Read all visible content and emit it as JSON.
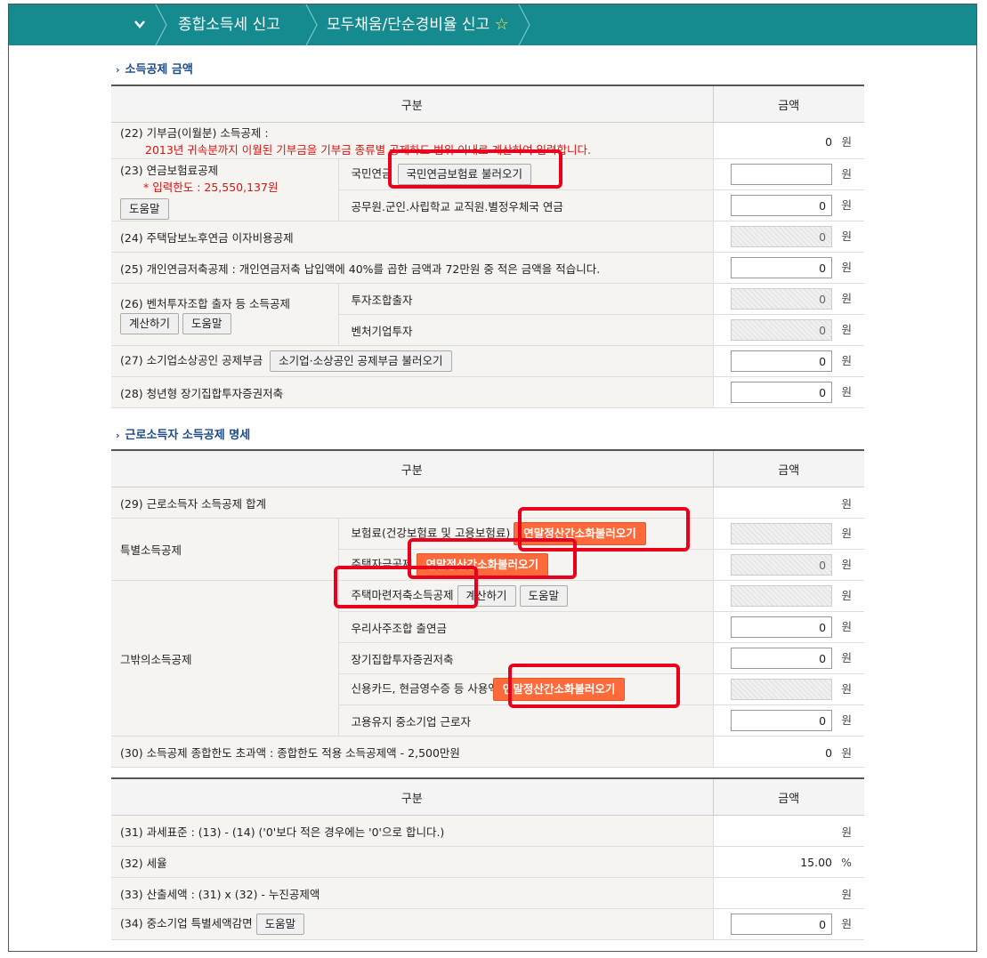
{
  "breadcrumb": {
    "item1": "종합소득세 신고",
    "item2": "모두채움/단순경비율 신고"
  },
  "icons": {
    "expand": "chevron-down-icon",
    "favorite": "star-icon",
    "section": "chevron-right-icon"
  },
  "common": {
    "won": "원",
    "percent": "%",
    "col_category": "구분",
    "col_amount": "금액"
  },
  "section1": {
    "title": "소득공제 금액",
    "rows": {
      "r22_label": "(22) 기부금(이월분) 소득공제 :",
      "r22_note": "2013년 귀속분까지 이월된 기부금을 기부금 종류별 공제하도 범위 이내로 계산하여 입력합니다.",
      "r22_value": "0",
      "r23_label": "(23) 연금보험료공제",
      "r23_limit": "* 입력한도 : 25,550,137원",
      "r23_help": "도움말",
      "r23_sub1": "국민연금",
      "r23_sub1_btn": "국민연금보험료 불러오기",
      "r23_sub1_value": "",
      "r23_sub2": "공무원.군인.사립학교 교직원.별정우체국 연금",
      "r23_sub2_value": "0",
      "r24_label": "(24) 주택담보노후연금 이자비용공제",
      "r24_value": "0",
      "r25_label": "(25) 개인연금저축공제 : 개인연금저축 납입액에 40%를 곱한 금액과 72만원 중 적은 금액을 적습니다.",
      "r25_value": "0",
      "r26_label": "(26) 벤처투자조합 출자 등 소득공제",
      "r26_calc": "계산하기",
      "r26_help": "도움말",
      "r26_sub1": "투자조합출자",
      "r26_sub1_value": "0",
      "r26_sub2": "벤처기업투자",
      "r26_sub2_value": "0",
      "r27_label": "(27) 소기업소상공인 공제부금",
      "r27_btn": "소기업·소상공인 공제부금 불러오기",
      "r27_value": "0",
      "r28_label": "(28) 청년형 장기집합투자증권저축",
      "r28_value": "0"
    }
  },
  "section2": {
    "title": "근로소득자 소득공제 명세",
    "rows": {
      "r29_label": "(29) 근로소득자 소득공제 합계",
      "special_label": "특별소득공제",
      "ins_label": "보험료(건강보험료 및 고용보험료)",
      "ins_btn": "연말정산간소화불러오기",
      "house_label": "주택자금공제",
      "house_btn": "연말정산간소화불러오기",
      "house_value": "0",
      "other_label": "그밖의소득공제",
      "savings_label": "주택마련저축소득공제",
      "savings_calc": "계산하기",
      "savings_help": "도움말",
      "esop_label": "우리사주조합 출연금",
      "esop_value": "0",
      "longterm_label": "장기집합투자증권저축",
      "longterm_value": "0",
      "card_label": "신용카드, 현금영수증 등 사용액",
      "card_btn": "연말정산간소화불러오기",
      "sme_label": "고용유지 중소기업 근로자",
      "sme_value": "0",
      "r30_label": "(30) 소득공제 종합한도 초과액 : 종합한도 적용 소득공제액 - 2,500만원",
      "r30_value": "0"
    }
  },
  "section3": {
    "rows": {
      "r31_label": "(31) 과세표준 : (13) - (14) ('0'보다 적은 경우에는 '0'으로 합니다.)",
      "r32_label": "(32) 세율",
      "r32_value": "15.00",
      "r33_label": "(33) 산출세액 : (31) x (32) - 누진공제액",
      "r34_label": "(34) 중소기업 특별세액감면",
      "r34_help": "도움말",
      "r34_value": "0"
    }
  },
  "colors": {
    "header": "#168b8f",
    "highlight": "#e8001c",
    "orange_button": "#ff6a3a",
    "section_title": "#1c4a86"
  }
}
